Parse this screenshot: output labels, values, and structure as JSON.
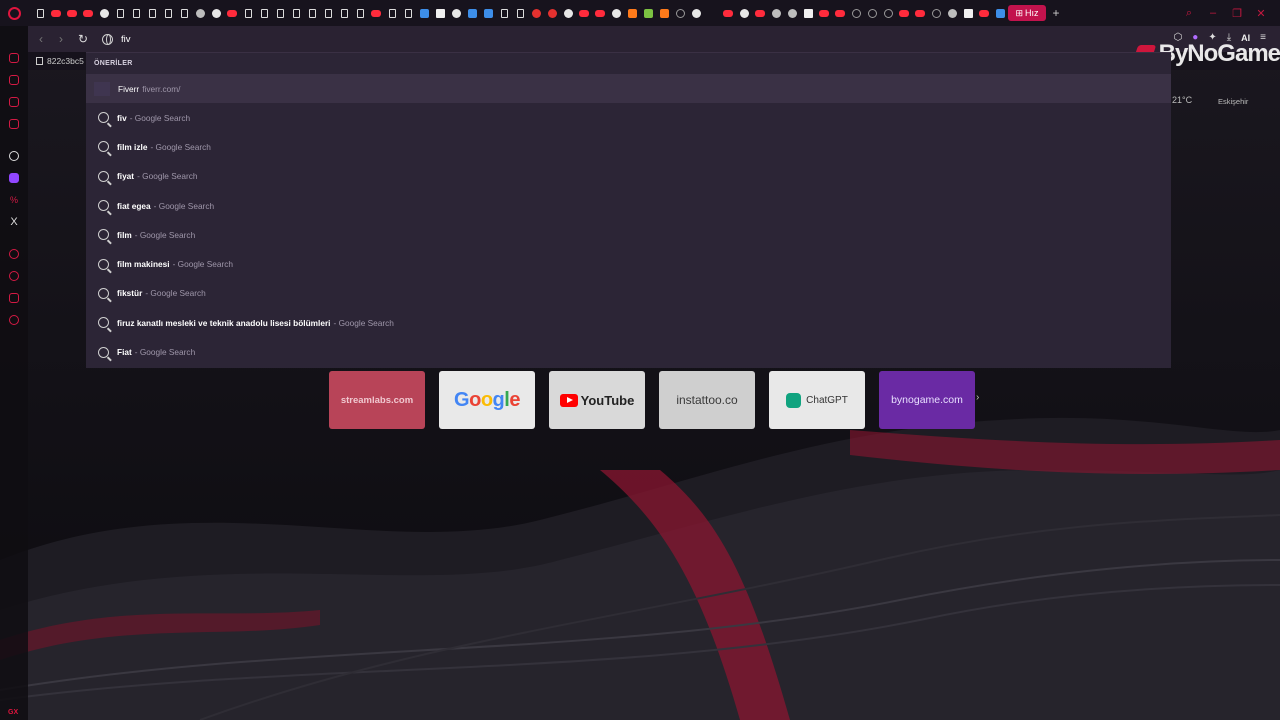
{
  "address_bar": {
    "value": "fiv"
  },
  "bookmark_strip": {
    "text": "822c3bc5"
  },
  "dropdown": {
    "heading": "ÖNERİLER",
    "top": {
      "query": "Fiverr",
      "source": "fiverr.com/"
    },
    "suggestions": [
      {
        "query": "fiv",
        "source": "- Google Search"
      },
      {
        "query": "film izle",
        "source": "- Google Search"
      },
      {
        "query": "fiyat",
        "source": "- Google Search"
      },
      {
        "query": "fiat egea",
        "source": "- Google Search"
      },
      {
        "query": "film",
        "source": "- Google Search"
      },
      {
        "query": "film makinesi",
        "source": "- Google Search"
      },
      {
        "query": "fikstür",
        "source": "- Google Search"
      },
      {
        "query": "firuz kanatlı mesleki ve teknik anadolu lisesi bölümleri",
        "source": "- Google Search"
      },
      {
        "query": "Fiat",
        "source": "- Google Search"
      }
    ]
  },
  "tabbar": {
    "active_tab": "Hız"
  },
  "toolbar": {
    "ai_label": "AI"
  },
  "overlay": {
    "brand": "ByNoGame",
    "weather": "21°C",
    "city": "Eskişehir"
  },
  "speed_dials": [
    {
      "label": "streamlabs.com"
    },
    {
      "label": "Google"
    },
    {
      "label": "YouTube"
    },
    {
      "label": "instattoo.co"
    },
    {
      "label": "ChatGPT"
    },
    {
      "label": "bynogame.com"
    }
  ],
  "sidebar": {
    "footer": "GX"
  },
  "colors": {
    "accent": "#e0153e",
    "dropdown_bg": "#2c2536",
    "selected_row": "#3a3145"
  }
}
